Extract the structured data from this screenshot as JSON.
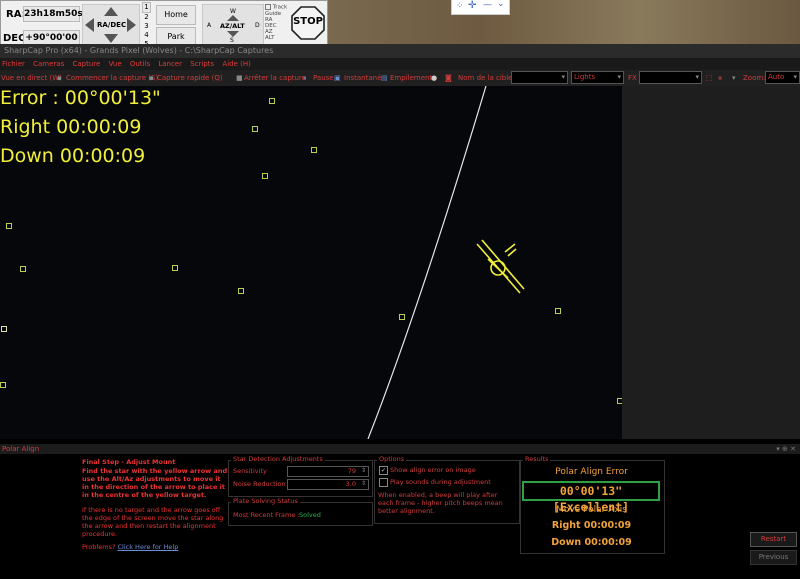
{
  "mount": {
    "ra_label": "RA:",
    "ra_value": "23h18m50s",
    "dec_label": "DEC:",
    "dec_value": "+90°00'00",
    "ra_dec_label": "RA/DEC",
    "speeds": [
      "1",
      "2",
      "3",
      "4",
      "5"
    ],
    "home_label": "Home",
    "park_label": "Park",
    "azalt_label": "AZ/ALT",
    "dir_w": "W",
    "dir_s": "S",
    "dir_a": "A",
    "dir_d": "D",
    "track_label": "Track",
    "guide_label": "Guide",
    "track_modes": [
      "RA",
      "DEC",
      "AZ",
      "ALT"
    ],
    "stop_label": "STOP"
  },
  "window": {
    "title": "SharpCap Pro (x64) - Grands Pixel (Wolves) - C:\\SharpCap Captures"
  },
  "menu": [
    "Fichier",
    "Cameras",
    "Capture",
    "Vue",
    "Outils",
    "Lancer",
    "Scripts",
    "Aide (H)"
  ],
  "toolbar": {
    "live_view": "Vue en direct (W)",
    "start_capture": "Commencer la capture (S)",
    "quick_capture": "Capture rapide (Q)",
    "stop_capture": "Arrêter la capture",
    "pause": "Pause",
    "snapshot": "Instantané",
    "stacking": "Empilement",
    "target_name_label": "Nom de la cible:",
    "target_name_value": "",
    "frame_type": "Lights",
    "fx_label": "FX",
    "fx_value": "",
    "zoom_label": "Zoom:",
    "zoom_value": "Auto"
  },
  "overlay": {
    "error_line": "Error : 00°00'13\"",
    "right_line": "Right 00:00:09",
    "down_line": "Down 00:00:09"
  },
  "panel": {
    "title": "Polar Align",
    "step_title": "Final Step - Adjust Mount",
    "step_instructions": "Find the star with the yellow arrow and use the Alt/Az adjustments to move it in the direction of the arrow to place it in the centre of the yellow target.",
    "step_help": "If there is no target and the arrow goes off the edge of the screen move the star along the arrow and then restart the alignment procedure.",
    "problems_label": "Problems?",
    "problems_link": "Click Here for Help",
    "star_detection": {
      "title": "Star Detection Adjustments",
      "sensitivity_label": "Sensitivity",
      "sensitivity_value": "79",
      "noise_label": "Noise Reduction",
      "noise_value": "3,0"
    },
    "plate_solving": {
      "title": "Plate Solving Status",
      "recent_label": "Most Recent Frame :",
      "recent_value": "Solved"
    },
    "options": {
      "title": "Options",
      "show_error_label": "Show align error on image",
      "show_error_checked": true,
      "play_sounds_label": "Play sounds during adjustment",
      "play_sounds_checked": false,
      "note": "When enabled, a beep will play after each frame - higher pitch beeps mean better alignment."
    },
    "results": {
      "title": "Results",
      "error_title": "Polar Align Error",
      "error_value": "00°00'13\" [Excellent]",
      "move_title": "Move Polar Axis",
      "right": "Right 00:00:09",
      "down": "Down 00:00:09"
    },
    "restart_label": "Restart",
    "previous_label": "Previous"
  },
  "colors": {
    "ui_red": "#d23c3c",
    "overlay_yellow": "#f1ef3a",
    "result_orange": "#f2a23a",
    "solved_green": "#22b14c",
    "excellent_border": "#2ea043"
  }
}
